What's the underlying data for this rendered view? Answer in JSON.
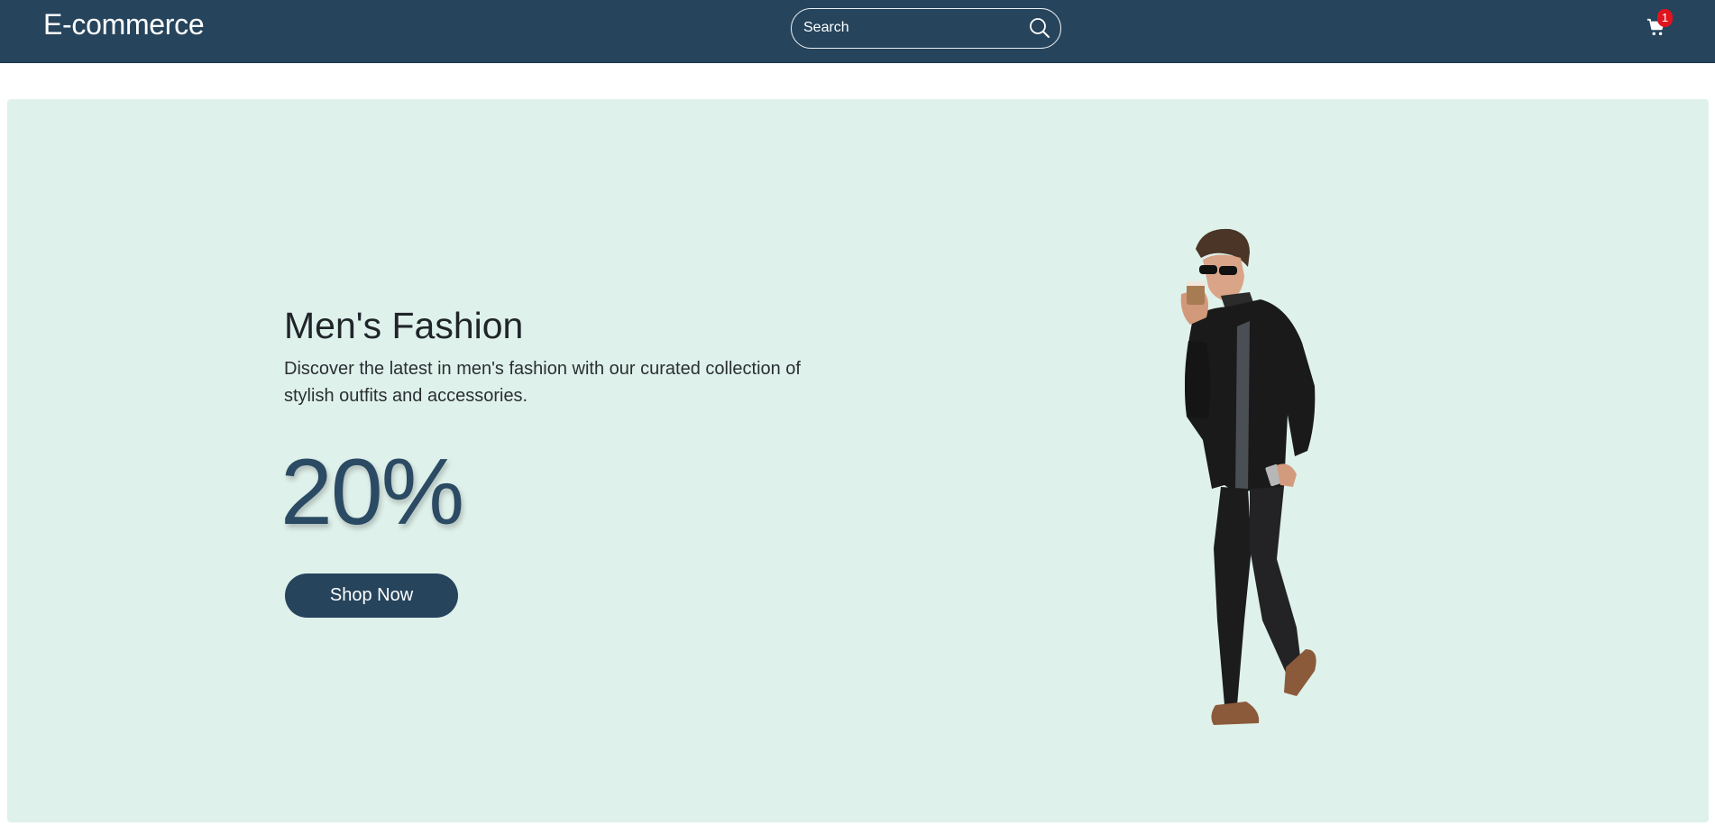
{
  "header": {
    "brand": "E-commerce",
    "search_placeholder": "Search",
    "cart_count": "1"
  },
  "hero": {
    "title": "Men's Fashion",
    "description": "Discover the latest in men's fashion with our curated collection of stylish outfits and accessories.",
    "discount": "20%",
    "cta_label": "Shop Now"
  },
  "colors": {
    "navbar": "#26445c",
    "hero_background": "#dff1eb",
    "accent": "#2b4a63",
    "badge": "#e0141e"
  },
  "icons": {
    "search": "search-icon",
    "cart": "cart-icon"
  }
}
